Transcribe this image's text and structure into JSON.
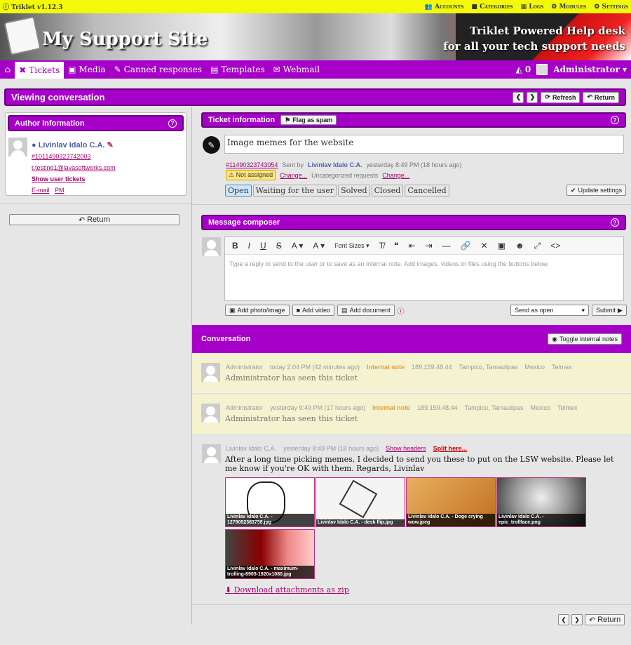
{
  "app": {
    "version": "Triklet v1.12.3"
  },
  "topnav": {
    "accounts": "Accounts",
    "categories": "Categories",
    "logs": "Logs",
    "modules": "Modules",
    "settings": "Settings"
  },
  "banner": {
    "title": "My Support Site",
    "tagline1": "Triklet Powered Help desk",
    "tagline2": "for all your tech support needs"
  },
  "nav": {
    "tickets": "Tickets",
    "media": "Media",
    "canned": "Canned responses",
    "templates": "Templates",
    "webmail": "Webmail",
    "mail_count": "0",
    "user": "Administrator"
  },
  "page": {
    "title": "Viewing conversation",
    "refresh": "Refresh",
    "return": "Return"
  },
  "author": {
    "header": "Author information",
    "name": "Livinlav Idalo C.A.",
    "id": "#1011490323742003",
    "email": "t.testing1@lavasoftworks.com",
    "show_tickets": "Show user tickets",
    "email_link": "E-mail",
    "pm_link": "PM",
    "return": "Return"
  },
  "ticket": {
    "header": "Ticket information",
    "flag_spam": "Flag as spam",
    "subject": "Image memes for the website",
    "number": "#11490323743054",
    "sent_by": "Sent by",
    "sender": "Livinlav Idalo C.A.",
    "sent_time": "yesterday 8:49 PM (18 hours ago)",
    "assigned": "Not assigned",
    "change": "Change...",
    "category": "Uncategorized requests",
    "change2": "Change...",
    "statuses": [
      "Open",
      "Waiting for the user",
      "Solved",
      "Closed",
      "Cancelled"
    ],
    "update": "Update settings"
  },
  "composer": {
    "header": "Message composer",
    "font_sizes": "Font Sizes",
    "placeholder": "Type a reply to send to the user or to save as an internal note. Add images, videos or files using the buttons below.",
    "add_photo": "Add photo/image",
    "add_video": "Add video",
    "add_doc": "Add document",
    "send_as": "Send as open",
    "submit": "Submit"
  },
  "conversation": {
    "header": "Conversation",
    "toggle": "Toggle internal notes",
    "notes": [
      {
        "author": "Administrator",
        "time": "today 2:04 PM (42 minutes ago)",
        "type": "Internal note",
        "ip": "189.159.48.44",
        "location": "Tampico, Tamaulipas",
        "country": "Mexico",
        "isp": "Telmex",
        "text": "Administrator has seen this ticket"
      },
      {
        "author": "Administrator",
        "time": "yesterday 9:49 PM (17 hours ago)",
        "type": "Internal note",
        "ip": "189.159.48.44",
        "location": "Tampico, Tamaulipas",
        "country": "Mexico",
        "isp": "Telmex",
        "text": "Administrator has seen this ticket"
      }
    ],
    "message": {
      "author": "Livinlav Idalo C.A.",
      "time": "yesterday 8:49 PM (18 hours ago)",
      "show_headers": "Show headers",
      "split": "Split here...",
      "text": "After a long time picking memes, I decided to send you these to put on the LSW website. Please let me know if you're OK with them. Regards, Livinlav",
      "attachments": [
        "Livinlav Idalo C.A. - 1279052383758.jpg",
        "Livinlav Idalo C.A. - desk flip.jpg",
        "Livinlav Idalo C.A. - Doge crying wow.jpeg",
        "Livinlav Idalo C.A. - epic_trollface.png",
        "Livinlav Idalo C.A. - maximum-trolling-8905-1920x1080.jpg"
      ],
      "download": "Download attachments as zip"
    },
    "return": "Return"
  },
  "colors": {
    "accent": "#a600c8",
    "topbar": "#f2f90a",
    "link": "#a6006e",
    "note_bg": "#f5f3cf"
  }
}
